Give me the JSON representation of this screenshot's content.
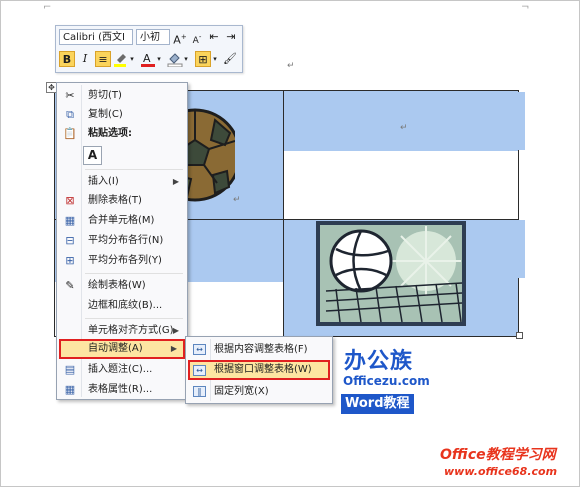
{
  "mini_toolbar": {
    "font_name": "Calibri (西文I",
    "font_size": "小初",
    "grow_font_icon": "font-grow",
    "shrink_font_icon": "font-shrink",
    "bold": "B",
    "italic": "I",
    "highlight_color": "#ffff00",
    "font_color": "#e02020"
  },
  "context_menu": {
    "items": [
      {
        "label": "剪切(T)",
        "icon": "scissors"
      },
      {
        "label": "复制(C)",
        "icon": "copy"
      },
      {
        "label": "粘贴选项:",
        "icon": "paste"
      },
      {
        "label": "插入(I)",
        "icon": ""
      },
      {
        "label": "删除表格(T)",
        "icon": "delete-table"
      },
      {
        "label": "合并单元格(M)",
        "icon": "merge-cells"
      },
      {
        "label": "平均分布各行(N)",
        "icon": "distribute-rows"
      },
      {
        "label": "平均分布各列(Y)",
        "icon": "distribute-columns"
      },
      {
        "label": "绘制表格(W)",
        "icon": "draw-table"
      },
      {
        "label": "边框和底纹(B)...",
        "icon": ""
      },
      {
        "label": "单元格对齐方式(G)",
        "icon": ""
      },
      {
        "label": "自动调整(A)",
        "icon": ""
      },
      {
        "label": "插入题注(C)...",
        "icon": "caption"
      },
      {
        "label": "表格属性(R)...",
        "icon": "table-properties"
      }
    ],
    "paste_option": "A"
  },
  "autofit_submenu": {
    "items": [
      {
        "label": "根据内容调整表格(F)"
      },
      {
        "label": "根据窗口调整表格(W)"
      },
      {
        "label": "固定列宽(X)"
      }
    ]
  },
  "watermark": {
    "brand": "办公族",
    "url": "Officezu.com",
    "product": "Word教程",
    "site_title": "Office教程学习网",
    "site_url": "www.office68.com"
  },
  "colors": {
    "selection": "#abc9f0",
    "highlight": "#fde5a2",
    "outline": "#e02020",
    "brand_blue": "#1e57c9",
    "brand_red": "#e8341d"
  }
}
